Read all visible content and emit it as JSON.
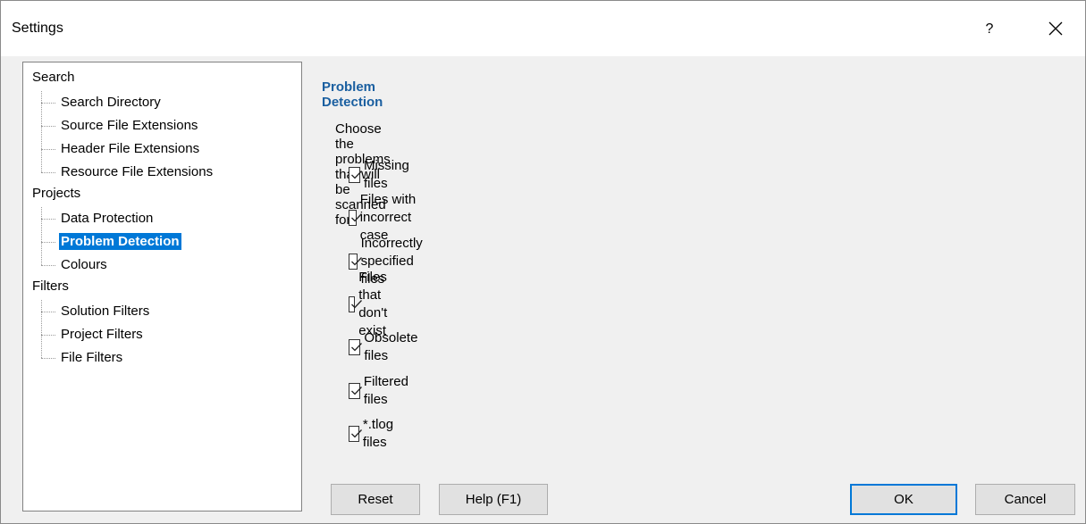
{
  "window": {
    "title": "Settings",
    "help_glyph": "?",
    "close_icon": "close-icon"
  },
  "tree": {
    "groups": [
      {
        "label": "Search",
        "children": [
          "Search Directory",
          "Source File Extensions",
          "Header File Extensions",
          "Resource File Extensions"
        ]
      },
      {
        "label": "Projects",
        "children": [
          "Data Protection",
          "Problem Detection",
          "Colours"
        ]
      },
      {
        "label": "Filters",
        "children": [
          "Solution Filters",
          "Project Filters",
          "File Filters"
        ]
      }
    ],
    "selected": "Problem Detection"
  },
  "panel": {
    "heading": "Problem Detection",
    "description": "Choose the problems that will be scanned for.",
    "options": [
      {
        "label": "Missing files",
        "checked": true
      },
      {
        "label": "Files with incorrect case",
        "checked": true
      },
      {
        "label": "Incorrectly specified files",
        "checked": true
      },
      {
        "label": "Files that don't exist",
        "checked": true
      },
      {
        "label": "Obsolete files",
        "checked": true
      },
      {
        "label": "Filtered files",
        "checked": true
      },
      {
        "label": "*.tlog files",
        "checked": true
      }
    ]
  },
  "buttons": {
    "reset": "Reset",
    "help": "Help (F1)",
    "ok": "OK",
    "cancel": "Cancel"
  },
  "colors": {
    "accent": "#0078d7",
    "heading": "#1a5fa0"
  }
}
